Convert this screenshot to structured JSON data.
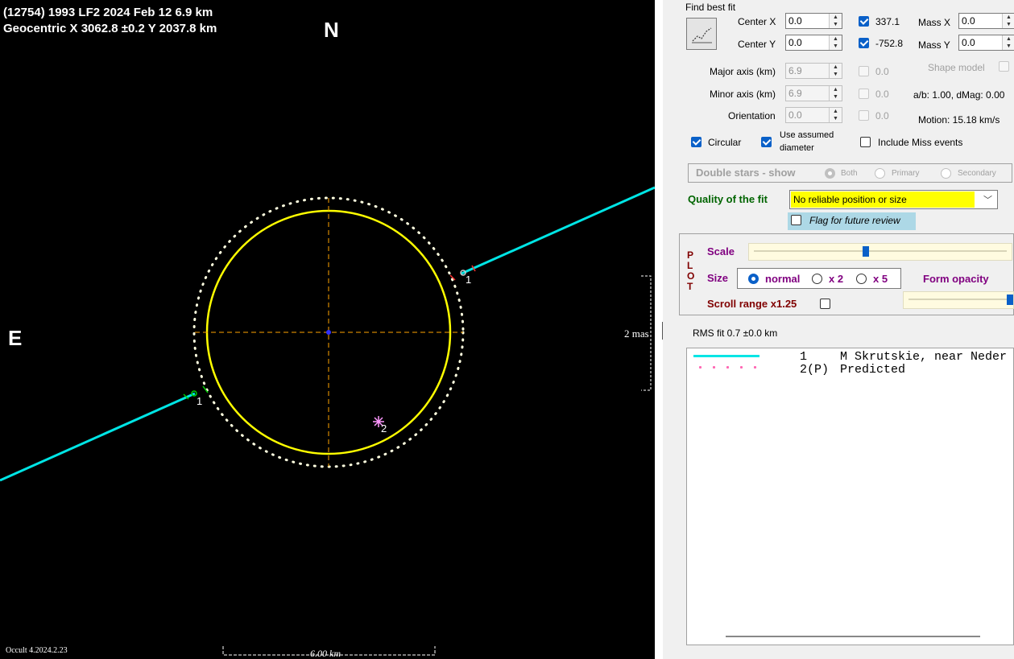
{
  "plot": {
    "title_line1": "(12754) 1993 LF2  2024 Feb 12   6.9 km",
    "title_line2": "Geocentric  X  3062.8 ±0.2  Y 2037.8 km",
    "north_label": "N",
    "east_label": "E",
    "scale_label": "2 mas",
    "version_label": "Occult 4.2024.2.23",
    "km_scale_label": "6.00 km",
    "chord_labels": [
      "1",
      "1",
      "2"
    ],
    "colors": {
      "background": "#000000",
      "ellipse": "#ffff00",
      "chord": "#00e5e5",
      "axes": "#ffa500"
    }
  },
  "panel": {
    "find_best_fit": "Find best fit",
    "center_x": {
      "label": "Center X",
      "value": "0.0",
      "fit_value": "337.1",
      "checked": true
    },
    "center_y": {
      "label": "Center Y",
      "value": "0.0",
      "fit_value": "-752.8",
      "checked": true
    },
    "mass_x": {
      "label": "Mass X",
      "value": "0.0"
    },
    "mass_y": {
      "label": "Mass Y",
      "value": "0.0"
    },
    "major_axis": {
      "label": "Major axis (km)",
      "value": "6.9",
      "fit_value": "0.0"
    },
    "minor_axis": {
      "label": "Minor axis (km)",
      "value": "6.9",
      "fit_value": "0.0"
    },
    "orientation": {
      "label": "Orientation",
      "value": "0.0",
      "fit_value": "0.0"
    },
    "shape_model": "Shape model",
    "ab_dmag": "a/b: 1.00, dMag: 0.00",
    "motion": "Motion: 15.18 km/s",
    "circular": {
      "label": "Circular",
      "checked": true
    },
    "use_assumed_l1": "Use assumed",
    "use_assumed_l2": "diameter",
    "include_miss": {
      "label": "Include Miss events",
      "checked": false
    },
    "double_stars": {
      "label": "Double stars - show",
      "options": [
        "Both",
        "Primary",
        "Secondary"
      ],
      "selected": "Both"
    },
    "quality_label": "Quality of the fit",
    "quality_value": "No reliable position or size",
    "flag_review": "Flag for future review",
    "plot_letters": [
      "P",
      "L",
      "O",
      "T"
    ],
    "scale_label": "Scale",
    "size_label": "Size",
    "size_options": [
      "normal",
      "x 2",
      "x 5"
    ],
    "size_selected": "normal",
    "form_opacity": "Form opacity",
    "scroll_range": "Scroll range x1.25",
    "scale_slider_fraction": 0.44,
    "opacity_slider_fraction": 1.0,
    "rms_fit": "RMS fit 0.7 ±0.0 km",
    "chords_list": [
      {
        "num": "1",
        "name": "M Skrutskie, near Neder",
        "style": "line",
        "color": "#00e5e5"
      },
      {
        "num": "2(P)",
        "name": "Predicted",
        "style": "dots",
        "color": "#ff69b4"
      }
    ]
  }
}
